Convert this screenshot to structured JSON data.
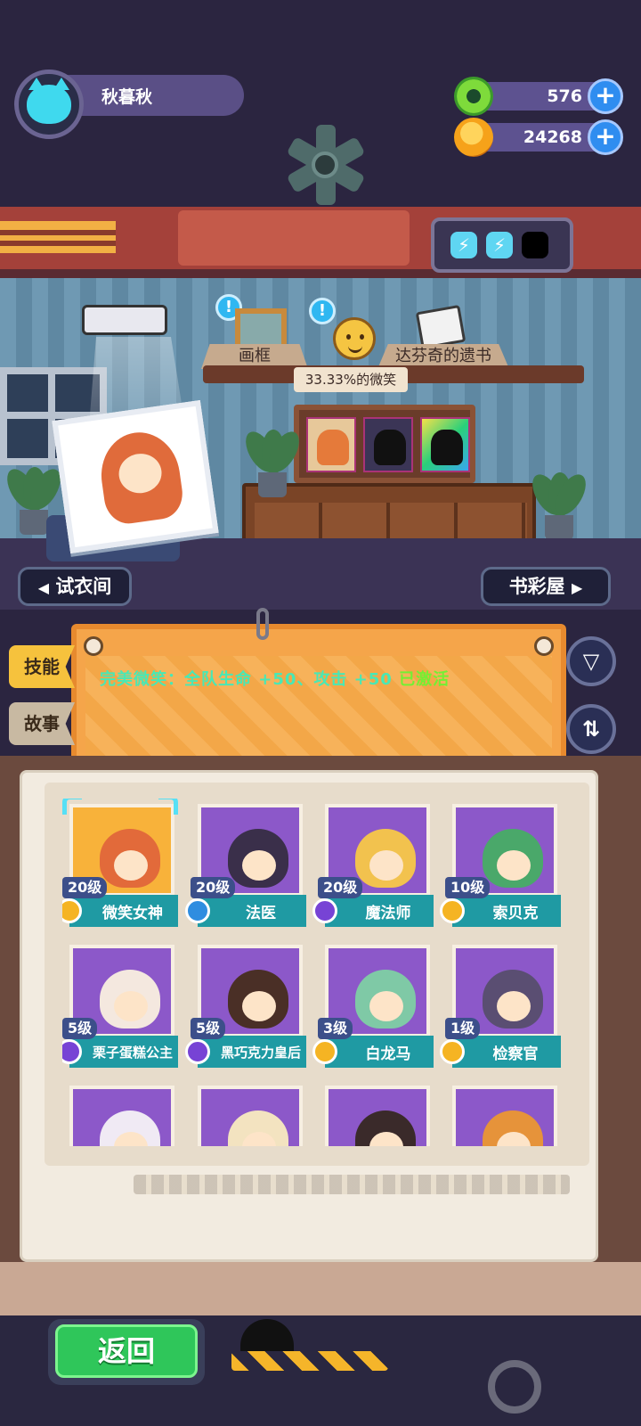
{
  "player": {
    "name": "秋暮秋"
  },
  "currencies": [
    {
      "icon": "green-gem-coin-icon",
      "value": "576"
    },
    {
      "icon": "orange-planet-coin-icon",
      "value": "24268"
    }
  ],
  "room": {
    "shelf_items": [
      "画框",
      "达芬奇的遗书"
    ],
    "mood": "33.33%的微笑",
    "left_nav": "试衣间",
    "right_nav": "书彩屋"
  },
  "skill_panel": {
    "tabs": [
      "技能",
      "故事"
    ],
    "description": "完美微笑：全队生命 +50、攻击 +50",
    "status": "已激活"
  },
  "characters": [
    {
      "name": "微笑女神",
      "level": "20级",
      "rank": "gold",
      "selected": true,
      "bg": "gold",
      "hair": "#e26a3a"
    },
    {
      "name": "法医",
      "level": "20级",
      "rank": "blue",
      "selected": false,
      "bg": "purple",
      "hair": "#3a2f4a"
    },
    {
      "name": "魔法师",
      "level": "20级",
      "rank": "purple",
      "selected": false,
      "bg": "purple",
      "hair": "#f2c24e"
    },
    {
      "name": "索贝克",
      "level": "10级",
      "rank": "gold",
      "selected": false,
      "bg": "purple",
      "hair": "#4aa86a"
    },
    {
      "name": "栗子蛋糕公主",
      "level": "5级",
      "rank": "purple",
      "selected": false,
      "bg": "purple",
      "hair": "#f4e8df"
    },
    {
      "name": "黑巧克力皇后",
      "level": "5级",
      "rank": "purple",
      "selected": false,
      "bg": "purple",
      "hair": "#4a2f26"
    },
    {
      "name": "白龙马",
      "level": "3级",
      "rank": "gold",
      "selected": false,
      "bg": "purple",
      "hair": "#7fc9a6"
    },
    {
      "name": "检察官",
      "level": "1级",
      "rank": "gold",
      "selected": false,
      "bg": "purple",
      "hair": "#5a4e72"
    },
    {
      "name": "",
      "level": "",
      "rank": "",
      "selected": false,
      "bg": "purple",
      "hair": "#f0eaf4"
    },
    {
      "name": "",
      "level": "",
      "rank": "",
      "selected": false,
      "bg": "purple",
      "hair": "#f3e3c0"
    },
    {
      "name": "",
      "level": "",
      "rank": "",
      "selected": false,
      "bg": "purple",
      "hair": "#3a2a2a"
    },
    {
      "name": "",
      "level": "",
      "rank": "",
      "selected": false,
      "bg": "purple",
      "hair": "#e6933a"
    }
  ],
  "footer": {
    "back_label": "返回"
  },
  "colors": {
    "accent_teal": "#1f9aa3",
    "active_green": "#73f033",
    "skill_text": "#48e8b5"
  }
}
